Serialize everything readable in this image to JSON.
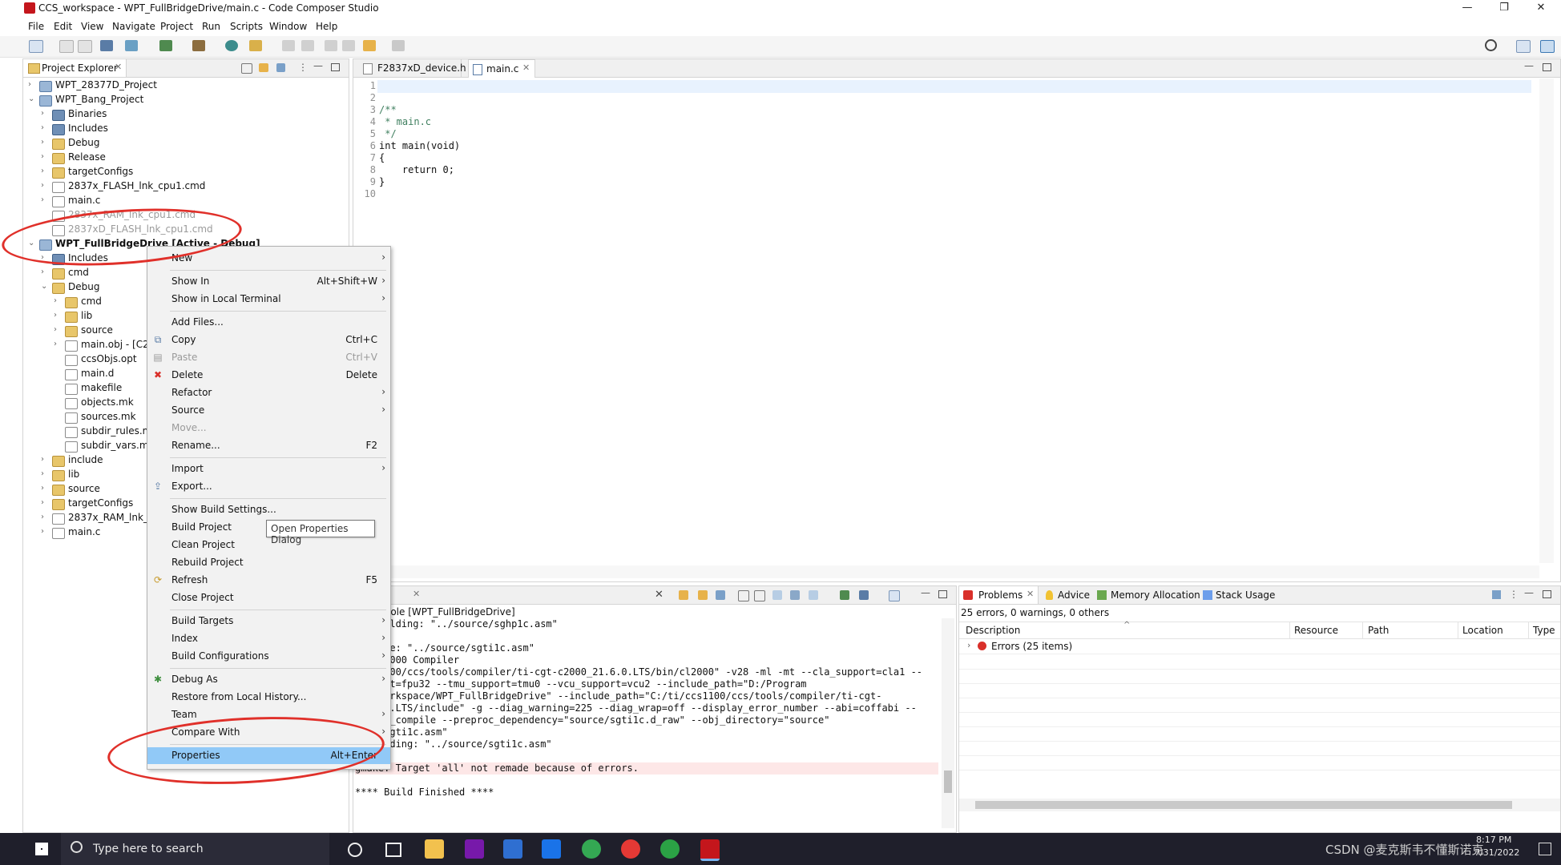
{
  "window": {
    "title": "CCS_workspace - WPT_FullBridgeDrive/main.c - Code Composer Studio",
    "min_label": "—",
    "max_label": "❐",
    "close_label": "✕"
  },
  "menu": [
    "File",
    "Edit",
    "View",
    "Navigate",
    "Project",
    "Run",
    "Scripts",
    "Window",
    "Help"
  ],
  "project_explorer": {
    "title": "Project Explorer",
    "tree": [
      {
        "label": "WPT_28377D_Project",
        "level": 0,
        "twisty": "›",
        "icon": "project-icon"
      },
      {
        "label": "WPT_Bang_Project",
        "level": 0,
        "twisty": "⌄",
        "icon": "project-icon"
      },
      {
        "label": "Binaries",
        "level": 1,
        "twisty": "›",
        "icon": "binaries-icon"
      },
      {
        "label": "Includes",
        "level": 1,
        "twisty": "›",
        "icon": "includes-icon"
      },
      {
        "label": "Debug",
        "level": 1,
        "twisty": "›",
        "icon": "folder-icon"
      },
      {
        "label": "Release",
        "level": 1,
        "twisty": "›",
        "icon": "folder-icon"
      },
      {
        "label": "targetConfigs",
        "level": 1,
        "twisty": "›",
        "icon": "folder-icon"
      },
      {
        "label": "2837x_FLASH_lnk_cpu1.cmd",
        "level": 1,
        "twisty": "›",
        "icon": "file-icon"
      },
      {
        "label": "main.c",
        "level": 1,
        "twisty": "›",
        "icon": "c-file-icon"
      },
      {
        "label": "2837x_RAM_lnk_cpu1.cmd",
        "level": 1,
        "twisty": "",
        "icon": "excluded-file-icon",
        "dim": true
      },
      {
        "label": "2837xD_FLASH_lnk_cpu1.cmd",
        "level": 1,
        "twisty": "",
        "icon": "excluded-file-icon",
        "dim": true
      },
      {
        "label": "WPT_FullBridgeDrive  [Active - Debug]",
        "level": 0,
        "twisty": "⌄",
        "icon": "project-icon",
        "bold": true
      },
      {
        "label": "Includes",
        "level": 1,
        "twisty": "›",
        "icon": "includes-icon"
      },
      {
        "label": "cmd",
        "level": 1,
        "twisty": "›",
        "icon": "folder-icon"
      },
      {
        "label": "Debug",
        "level": 1,
        "twisty": "⌄",
        "icon": "folder-icon"
      },
      {
        "label": "cmd",
        "level": 2,
        "twisty": "›",
        "icon": "folder-icon"
      },
      {
        "label": "lib",
        "level": 2,
        "twisty": "›",
        "icon": "folder-icon"
      },
      {
        "label": "source",
        "level": 2,
        "twisty": "›",
        "icon": "folder-icon"
      },
      {
        "label": "main.obj - [C2",
        "level": 2,
        "twisty": "›",
        "icon": "obj-file-icon"
      },
      {
        "label": "ccsObjs.opt",
        "level": 2,
        "twisty": "",
        "icon": "file-icon"
      },
      {
        "label": "main.d",
        "level": 2,
        "twisty": "",
        "icon": "file-icon"
      },
      {
        "label": "makefile",
        "level": 2,
        "twisty": "",
        "icon": "file-icon"
      },
      {
        "label": "objects.mk",
        "level": 2,
        "twisty": "",
        "icon": "file-icon"
      },
      {
        "label": "sources.mk",
        "level": 2,
        "twisty": "",
        "icon": "file-icon"
      },
      {
        "label": "subdir_rules.m",
        "level": 2,
        "twisty": "",
        "icon": "file-icon"
      },
      {
        "label": "subdir_vars.mk",
        "level": 2,
        "twisty": "",
        "icon": "file-icon"
      },
      {
        "label": "include",
        "level": 1,
        "twisty": "›",
        "icon": "folder-icon"
      },
      {
        "label": "lib",
        "level": 1,
        "twisty": "›",
        "icon": "folder-icon"
      },
      {
        "label": "source",
        "level": 1,
        "twisty": "›",
        "icon": "folder-icon"
      },
      {
        "label": "targetConfigs",
        "level": 1,
        "twisty": "›",
        "icon": "folder-icon"
      },
      {
        "label": "2837x_RAM_lnk_c",
        "level": 1,
        "twisty": "›",
        "icon": "file-icon"
      },
      {
        "label": "main.c",
        "level": 1,
        "twisty": "›",
        "icon": "c-file-icon"
      }
    ]
  },
  "editor": {
    "tabs": [
      {
        "label": "F2837xD_device.h",
        "active": false
      },
      {
        "label": "main.c",
        "active": true
      }
    ],
    "lines": [
      {
        "n": "1",
        "text": ""
      },
      {
        "n": "2",
        "text": ""
      },
      {
        "n": "3",
        "text": "/**"
      },
      {
        "n": "4",
        "text": " * main.c"
      },
      {
        "n": "5",
        "text": " */"
      },
      {
        "n": "6",
        "text": "int main(void)"
      },
      {
        "n": "7",
        "text": "{"
      },
      {
        "n": "8",
        "text": "    return 0;"
      },
      {
        "n": "9",
        "text": "}"
      },
      {
        "n": "10",
        "text": ""
      }
    ]
  },
  "context_menu": {
    "items": [
      {
        "label": "New",
        "shortcut": "",
        "submenu": true
      },
      {
        "sep": true
      },
      {
        "label": "Show In",
        "shortcut": "Alt+Shift+W",
        "submenu": true
      },
      {
        "label": "Show in Local Terminal",
        "shortcut": "",
        "submenu": true
      },
      {
        "sep": true
      },
      {
        "label": "Add Files...",
        "shortcut": ""
      },
      {
        "label": "Copy",
        "shortcut": "Ctrl+C",
        "icon": "copy-icon"
      },
      {
        "label": "Paste",
        "shortcut": "Ctrl+V",
        "icon": "paste-icon",
        "disabled": true
      },
      {
        "label": "Delete",
        "shortcut": "Delete",
        "icon": "delete-icon"
      },
      {
        "label": "Refactor",
        "shortcut": "",
        "submenu": true
      },
      {
        "label": "Source",
        "shortcut": "",
        "submenu": true
      },
      {
        "label": "Move...",
        "shortcut": "",
        "disabled": true
      },
      {
        "label": "Rename...",
        "shortcut": "F2"
      },
      {
        "sep": true
      },
      {
        "label": "Import",
        "shortcut": "",
        "submenu": true
      },
      {
        "label": "Export...",
        "shortcut": "",
        "icon": "export-icon"
      },
      {
        "sep": true
      },
      {
        "label": "Show Build Settings...",
        "shortcut": ""
      },
      {
        "label": "Build Project",
        "shortcut": ""
      },
      {
        "label": "Clean Project",
        "shortcut": ""
      },
      {
        "label": "Rebuild Project",
        "shortcut": ""
      },
      {
        "label": "Refresh",
        "shortcut": "F5",
        "icon": "refresh-icon"
      },
      {
        "label": "Close Project",
        "shortcut": ""
      },
      {
        "sep": true
      },
      {
        "label": "Build Targets",
        "shortcut": "",
        "submenu": true
      },
      {
        "label": "Index",
        "shortcut": "",
        "submenu": true
      },
      {
        "label": "Build Configurations",
        "shortcut": "",
        "submenu": true
      },
      {
        "sep": true
      },
      {
        "label": "Debug As",
        "shortcut": "",
        "submenu": true,
        "icon": "debug-icon"
      },
      {
        "label": "Restore from Local History...",
        "shortcut": ""
      },
      {
        "label": "Team",
        "shortcut": "",
        "submenu": true
      },
      {
        "label": "Compare With",
        "shortcut": "",
        "submenu": true
      },
      {
        "sep": true
      },
      {
        "label": "Properties",
        "shortcut": "Alt+Enter",
        "selected": true
      }
    ],
    "tooltip": "Open Properties Dialog"
  },
  "console": {
    "tab_label": "sole",
    "header": "ld Console [WPT_FullBridgeDrive]",
    "lines": [
      "ed building: \"../source/sghp1c.asm\"",
      "",
      "ng file: \"../source/sgti1c.asm\"",
      "ng: C2000 Compiler",
      "/ccs1100/ccs/tools/compiler/ti-cgt-c2000_21.6.0.LTS/bin/cl2000\" -v28 -ml -mt --cla_support=cla1 --",
      "support=fpu32 --tmu_support=tmu0 --vcu_support=vcu2 --include_path=\"D:/Program",
      "CCS_workspace/WPT_FullBridgeDrive\" --include_path=\"C:/ti/ccs1100/ccs/tools/compiler/ti-cgt-",
      "21.6.0.LTS/include\" -g --diag_warning=225 --diag_wrap=off --display_error_number --abi=coffabi --",
      "c_with_compile --preproc_dependency=\"source/sgti1c.d_raw\" --obj_directory=\"source\"",
      "urce/sgti1c.asm\"",
      "d building: \"../source/sgti1c.asm\"",
      "",
      "gmake: Target 'all' not remade because of errors.",
      "",
      "**** Build Finished ****"
    ]
  },
  "problems": {
    "tabs": [
      "Problems",
      "Advice",
      "Memory Allocation",
      "Stack Usage"
    ],
    "summary": "25 errors, 0 warnings, 0 others",
    "columns": [
      "Description",
      "Resource",
      "Path",
      "Location",
      "Type"
    ],
    "rows": [
      {
        "label": "Errors (25 items)"
      }
    ]
  },
  "taskbar": {
    "search_placeholder": "Type here to search",
    "time": "8:17 PM",
    "date": "7/31/2022",
    "watermark": "CSDN @麦克斯韦不懂斯诺克"
  },
  "colors": {
    "accent": "#91c9f7",
    "annotation": "#e0302a",
    "error": "#d9302a"
  }
}
